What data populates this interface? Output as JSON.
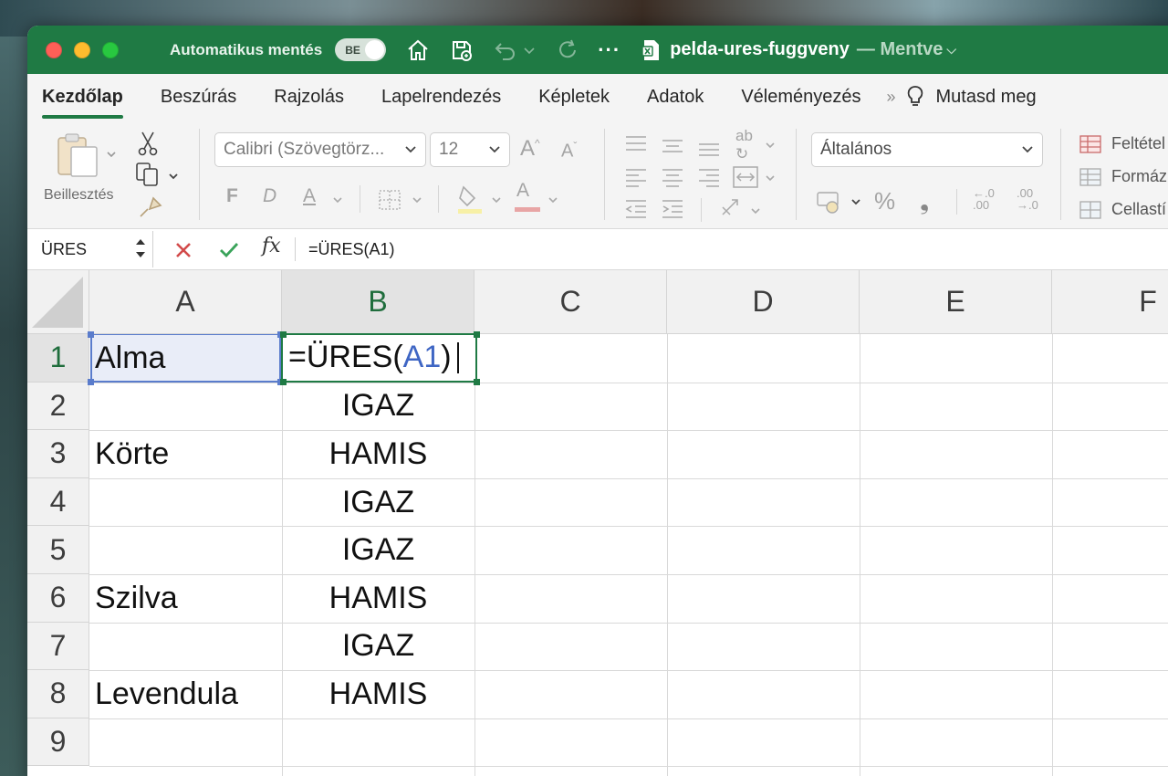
{
  "titlebar": {
    "autosave_label": "Automatikus mentés",
    "autosave_toggle_text": "BE",
    "doc_name": "pelda-ures-fuggveny",
    "doc_status": "— Mentve",
    "accent_color": "#1f7a44"
  },
  "tabs": {
    "items": [
      "Kezdőlap",
      "Beszúrás",
      "Rajzolás",
      "Lapelrendezés",
      "Képletek",
      "Adatok",
      "Véleményezés"
    ],
    "active": "Kezdőlap",
    "help": "Mutasd meg"
  },
  "ribbon": {
    "paste_label": "Beillesztés",
    "font_name": "Calibri (Szövegtörz...",
    "font_size": "12",
    "bold": "F",
    "italic": "D",
    "underline": "A",
    "font_color": "A",
    "number_format": "Általános",
    "percent": "%",
    "comma": "❟",
    "styles": [
      "Feltétel",
      "Formáz",
      "Cellastí"
    ]
  },
  "formula_bar": {
    "name_box": "ÜRES",
    "formula": "=ÜRES(A1)"
  },
  "sheet": {
    "columns": [
      "A",
      "B",
      "C",
      "D",
      "E",
      "F"
    ],
    "rows": [
      "1",
      "2",
      "3",
      "4",
      "5",
      "6",
      "7",
      "8",
      "9"
    ],
    "active_col": "B",
    "active_row": "1",
    "editing": {
      "prefix": "=ÜRES(",
      "ref": "A1",
      "suffix": ")"
    },
    "colA": [
      "Alma",
      "",
      "Körte",
      "",
      "",
      "Szilva",
      "",
      "Levendula",
      ""
    ],
    "colB": [
      "",
      "IGAZ",
      "HAMIS",
      "IGAZ",
      "IGAZ",
      "HAMIS",
      "IGAZ",
      "HAMIS",
      ""
    ]
  }
}
